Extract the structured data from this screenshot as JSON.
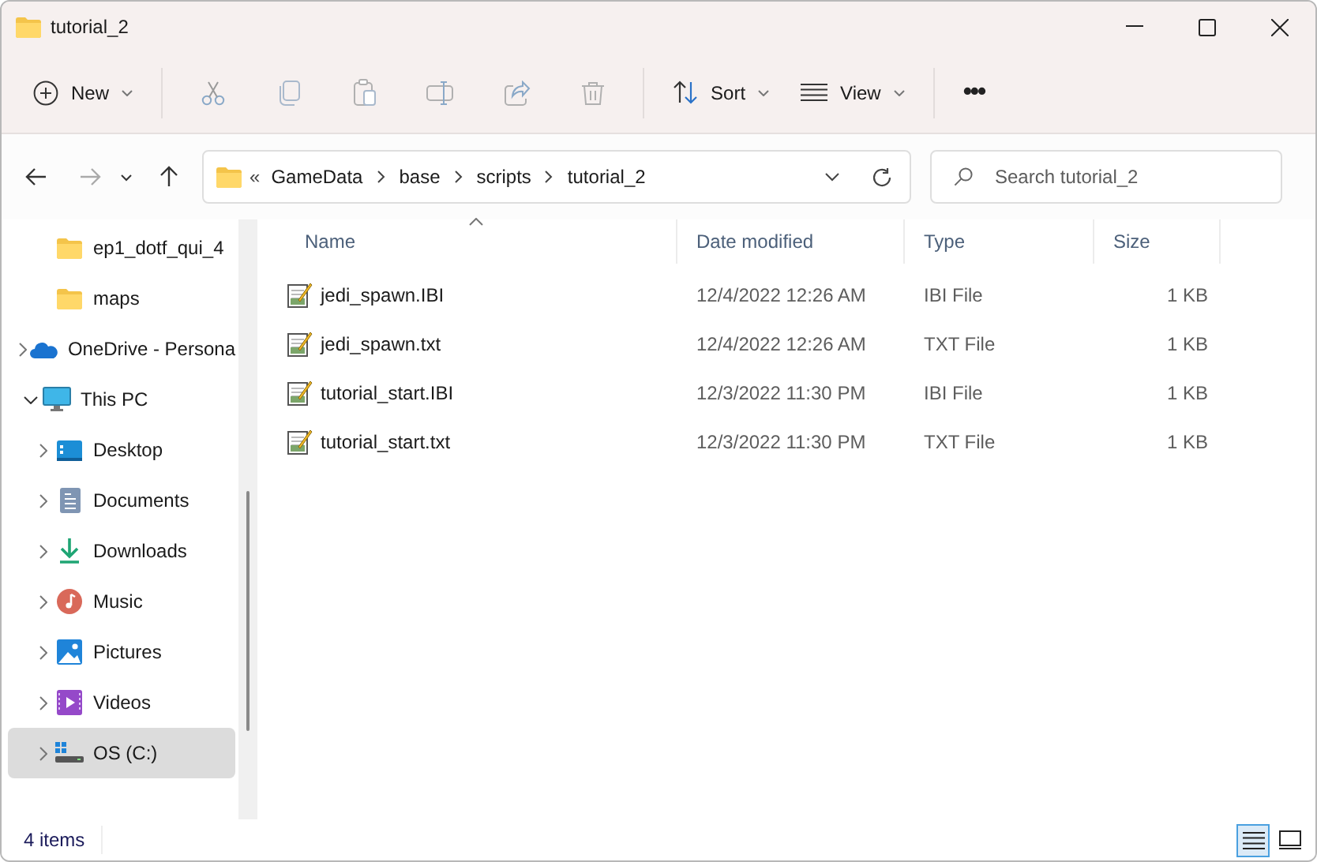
{
  "window": {
    "title": "tutorial_2"
  },
  "toolbar": [
    {
      "kind": "labeled",
      "label": "New",
      "disabled": false
    },
    {
      "kind": "icon",
      "disabled": true
    },
    {
      "kind": "icon",
      "disabled": true
    },
    {
      "kind": "icon",
      "disabled": true
    },
    {
      "kind": "icon",
      "disabled": true
    },
    {
      "kind": "icon",
      "disabled": true
    },
    {
      "kind": "icon",
      "disabled": true
    },
    {
      "kind": "labeled",
      "label": "Sort",
      "disabled": false
    },
    {
      "kind": "labeled",
      "label": "View",
      "disabled": false
    },
    {
      "kind": "more",
      "label": "•••",
      "disabled": false
    }
  ],
  "address_bar": {
    "overflow": "«",
    "path": [
      "GameData",
      "base",
      "scripts",
      "tutorial_2"
    ]
  },
  "search": {
    "placeholder": "Search tutorial_2"
  },
  "sidebar": {
    "items": [
      {
        "kind": "folder",
        "label": "ep1_dotf_qui_4",
        "selected": false
      },
      {
        "kind": "folder",
        "label": "maps",
        "selected": false
      },
      {
        "kind": "cloud",
        "label": "OneDrive - Persona",
        "expanded": false,
        "selected": false
      },
      {
        "kind": "pc",
        "label": "This PC",
        "expanded": true,
        "selected": false,
        "children": [
          {
            "kind": "desktop",
            "label": "Desktop",
            "expanded": false,
            "selected": false
          },
          {
            "kind": "documents",
            "label": "Documents",
            "expanded": false,
            "selected": false
          },
          {
            "kind": "downloads",
            "label": "Downloads",
            "expanded": false,
            "selected": false
          },
          {
            "kind": "music",
            "label": "Music",
            "expanded": false,
            "selected": false
          },
          {
            "kind": "pictures",
            "label": "Pictures",
            "expanded": false,
            "selected": false
          },
          {
            "kind": "videos",
            "label": "Videos",
            "expanded": false,
            "selected": false
          },
          {
            "kind": "drive",
            "label": "OS (C:)",
            "expanded": false,
            "selected": true
          }
        ]
      }
    ]
  },
  "table": {
    "columns": [
      {
        "label": "Name",
        "sorted": true
      },
      {
        "label": "Date modified"
      },
      {
        "label": "Type"
      },
      {
        "label": "Size"
      }
    ],
    "rows": [
      {
        "name": "jedi_spawn.IBI",
        "date": "12/4/2022 12:26 AM",
        "type": "IBI File",
        "size": "1 KB"
      },
      {
        "name": "jedi_spawn.txt",
        "date": "12/4/2022 12:26 AM",
        "type": "TXT File",
        "size": "1 KB"
      },
      {
        "name": "tutorial_start.IBI",
        "date": "12/3/2022 11:30 PM",
        "type": "IBI File",
        "size": "1 KB"
      },
      {
        "name": "tutorial_start.txt",
        "date": "12/3/2022 11:30 PM",
        "type": "TXT File",
        "size": "1 KB"
      }
    ]
  },
  "status_bar": {
    "text": "4 items",
    "views": [
      {
        "kind": "details",
        "selected": true
      },
      {
        "kind": "tiles",
        "selected": false
      }
    ]
  }
}
